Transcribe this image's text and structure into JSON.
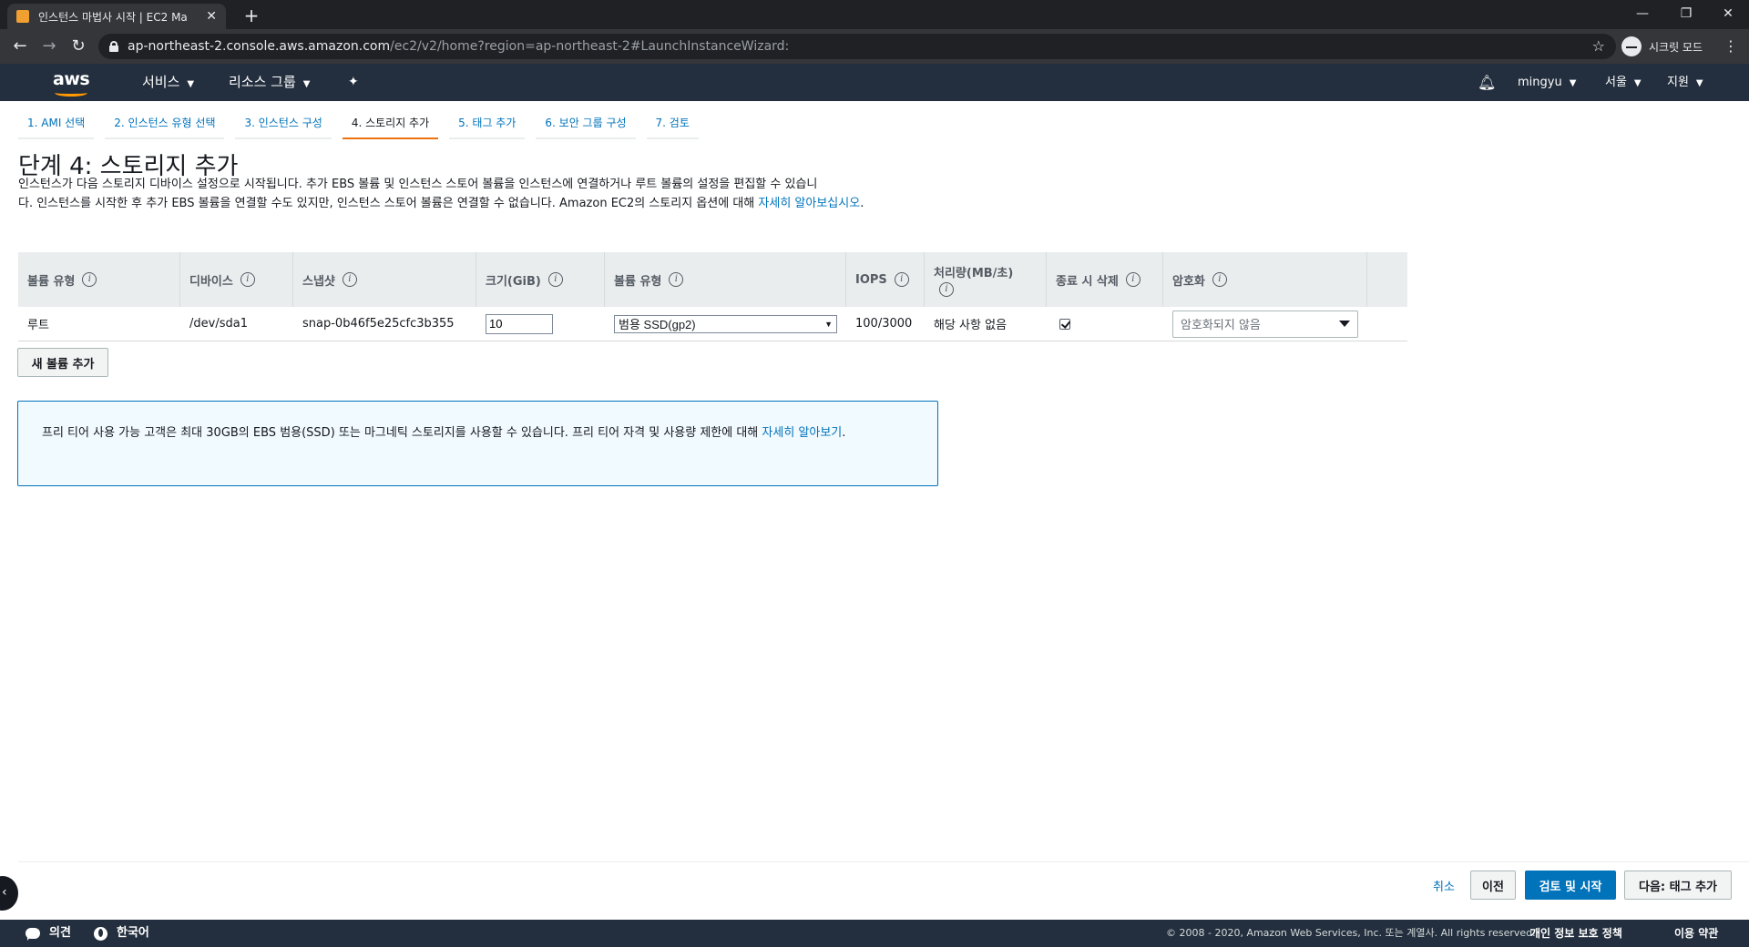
{
  "browser": {
    "tab_title": "인스턴스 마법사 시작 | EC2 Ma",
    "url_host": "ap-northeast-2.console.aws.amazon.com",
    "url_path": "/ec2/v2/home?region=ap-northeast-2#LaunchInstanceWizard:",
    "incognito_label": "시크릿 모드"
  },
  "header": {
    "logo_text": "aws",
    "services": "서비스",
    "resource_groups": "리소스 그룹",
    "user": "mingyu",
    "region": "서울",
    "support": "지원"
  },
  "steps": [
    {
      "label": "1. AMI 선택"
    },
    {
      "label": "2. 인스턴스 유형 선택"
    },
    {
      "label": "3. 인스턴스 구성"
    },
    {
      "label": "4. 스토리지 추가"
    },
    {
      "label": "5. 태그 추가"
    },
    {
      "label": "6. 보안 그룹 구성"
    },
    {
      "label": "7. 검토"
    }
  ],
  "page": {
    "title": "단계 4: 스토리지 추가",
    "desc_line1": "인스턴스가 다음 스토리지 디바이스 설정으로 시작됩니다. 추가 EBS 볼륨 및 인스턴스 스토어 볼륨을 인스턴스에 연결하거나 루트 볼륨의 설정을 편집할 수 있습니",
    "desc_line2": "다. 인스턴스를 시작한 후 추가 EBS 볼륨을 연결할 수도 있지만, 인스턴스 스토어 볼륨은 연결할 수 없습니다. Amazon EC2의 스토리지 옵션에 대해 ",
    "desc_link": "자세히 알아보십시오",
    "desc_end": "."
  },
  "table": {
    "headers": {
      "volume_type": "볼륨 유형",
      "device": "디바이스",
      "snapshot": "스냅샷",
      "size": "크기(GiB)",
      "ebs_type": "볼륨 유형",
      "iops": "IOPS",
      "throughput": "처리량(MB/초)",
      "delete_on_term": "종료 시 삭제",
      "encryption": "암호화"
    },
    "row": {
      "volume_type": "루트",
      "device": "/dev/sda1",
      "snapshot": "snap-0b46f5e25cfc3b355",
      "size": "10",
      "ebs_type": "범용 SSD(gp2)",
      "iops": "100/3000",
      "throughput": "해당 사항 없음",
      "delete_on_term": true,
      "encryption": "암호화되지 않음"
    }
  },
  "add_volume_button": "새 볼륨 추가",
  "info": {
    "text": "프리 티어 사용 가능 고객은 최대 30GB의 EBS 범용(SSD) 또는 마그네틱 스토리지를 사용할 수 있습니다. 프리 티어 자격 및 사용량 제한에 대해 ",
    "link": "자세히 알아보기",
    "end": "."
  },
  "actions": {
    "cancel": "취소",
    "previous": "이전",
    "review_launch": "검토 및 시작",
    "next": "다음: 태그 추가"
  },
  "footer": {
    "feedback": "의견",
    "language": "한국어",
    "copyright": "© 2008 - 2020, Amazon Web Services, Inc. 또는 계열사. All rights reserved.",
    "privacy": "개인 정보 보호 정책",
    "terms": "이용 약관"
  },
  "colors": {
    "nav_bg": "#232f3e",
    "accent": "#ec7211",
    "link": "#0073bb"
  }
}
